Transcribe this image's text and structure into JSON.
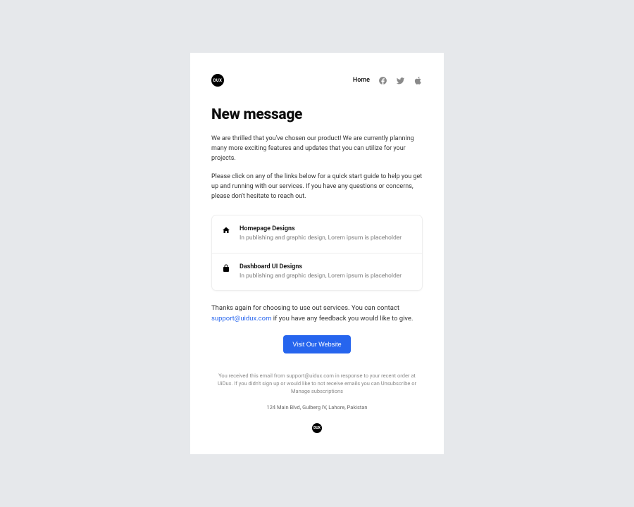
{
  "brand": {
    "logo_text": "DUX"
  },
  "nav": {
    "home": "Home"
  },
  "title": "New message",
  "paragraphs": {
    "p1": "We are thrilled that you've chosen our product! We are currently planning many more exciting features and updates that you can utilize for your projects.",
    "p2": "Please click on any of the links below for a quick start guide to help you get up and running with our services. If you have any questions or concerns, please don't hesitate to reach out."
  },
  "cards": [
    {
      "title": "Homepage Designs",
      "desc": "In publishing and graphic design, Lorem ipsum is placeholder"
    },
    {
      "title": "Dashboard UI Designs",
      "desc": "In publishing and graphic design, Lorem ipsum is placeholder"
    }
  ],
  "thanks": {
    "pre": "Thanks again for choosing to use out services. You can contact ",
    "email": "support@uidux.com",
    "post": " if you have any feedback you would like to give."
  },
  "cta": {
    "label": "Visit Our Website"
  },
  "footer": {
    "disclaimer": "You received this email from support@uidux.com in response to your recent order at UiDux. If you didn't sign up or would like to not receive emails you can Unsubscribe or Manage subscriptions",
    "address": "124 Main Blvd, Gulberg IV, Lahore, Pakistan",
    "logo_text": "DUX"
  }
}
